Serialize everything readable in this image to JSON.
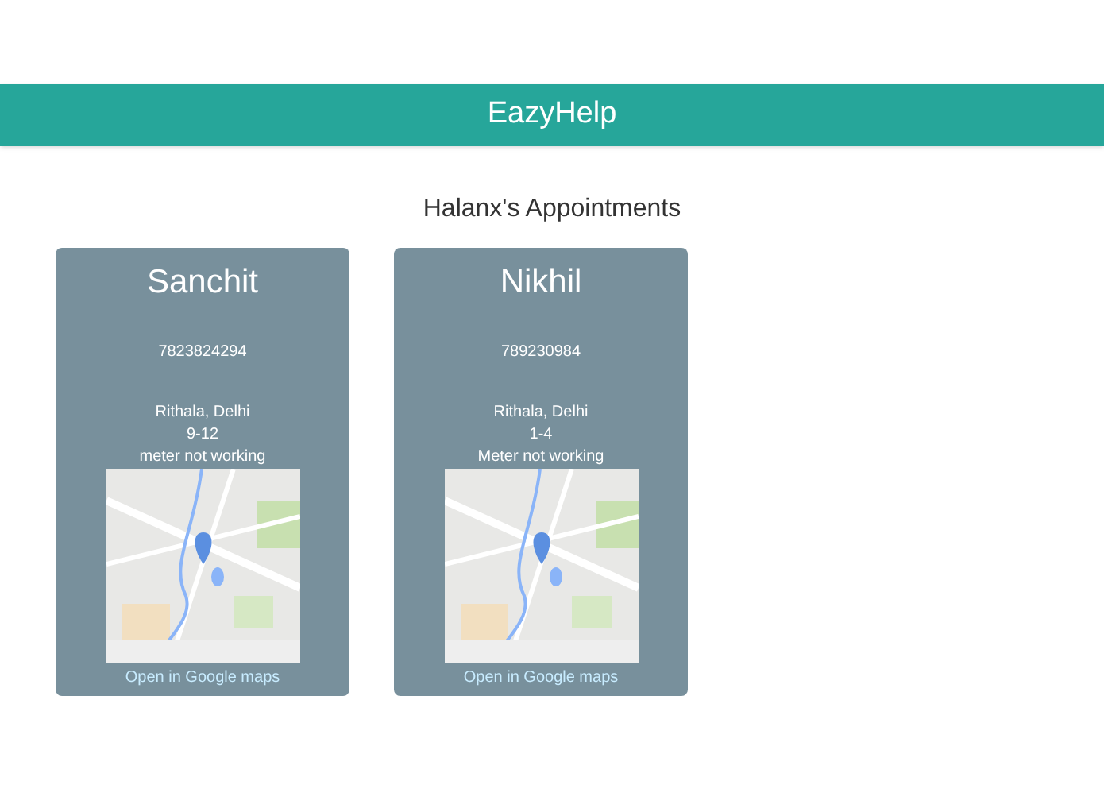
{
  "header": {
    "title": "EazyHelp"
  },
  "heading": "Halanx's Appointments",
  "appointments": [
    {
      "name": "Sanchit",
      "phone": "7823824294",
      "location": "Rithala, Delhi",
      "time": "9-12",
      "issue": "meter not working",
      "link": "Open in Google maps"
    },
    {
      "name": "Nikhil",
      "phone": "789230984",
      "location": "Rithala, Delhi",
      "time": "1-4",
      "issue": "Meter not working",
      "link": "Open in Google maps"
    }
  ]
}
